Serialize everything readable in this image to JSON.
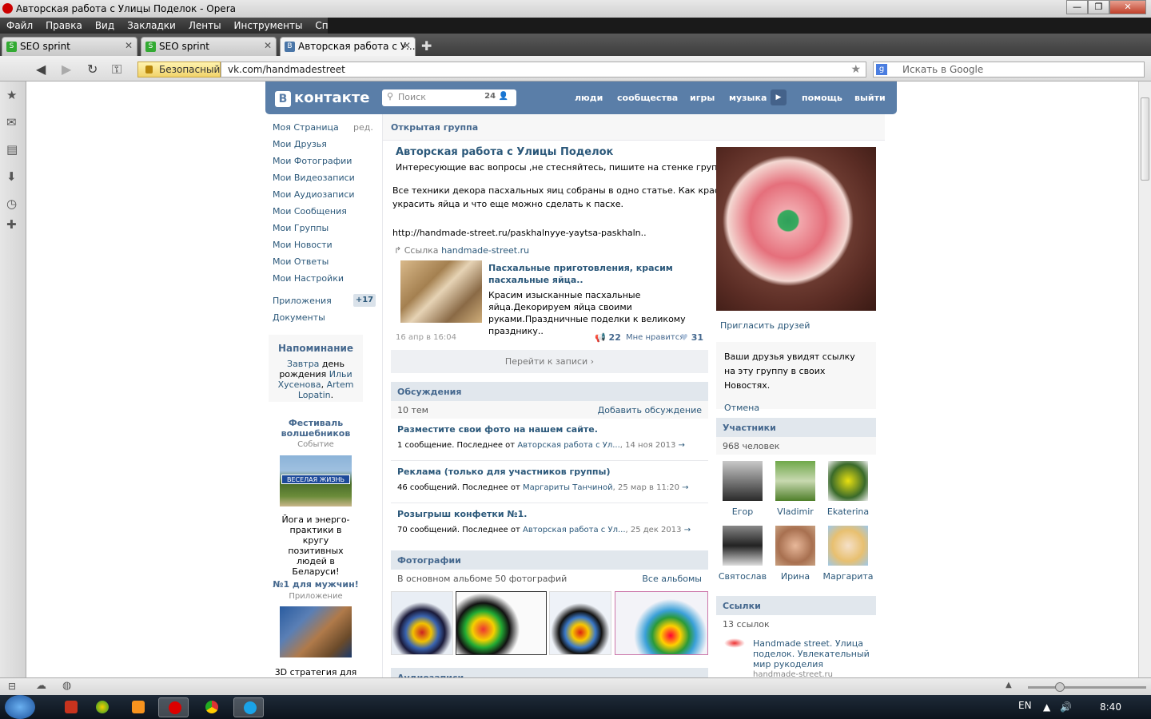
{
  "window": {
    "title": "Авторская работа с Улицы Поделок - Opera",
    "controls": [
      "—",
      "❐",
      "✕"
    ]
  },
  "menu": [
    "Файл",
    "Правка",
    "Вид",
    "Закладки",
    "Ленты",
    "Инструменты",
    "Справка"
  ],
  "tabs": [
    {
      "label": "SEO sprint",
      "icon": "S"
    },
    {
      "label": "SEO sprint",
      "icon": "S"
    },
    {
      "label": "Авторская работа с У...",
      "icon": "B"
    }
  ],
  "address": {
    "security_label": "Безопасный",
    "url": "vk.com/handmadestreet",
    "search_placeholder": "Искать в Google"
  },
  "vk": {
    "logo": "контакте",
    "logo_letter": "B",
    "search_placeholder": "Поиск",
    "search_count": "24",
    "nav": [
      "люди",
      "сообщества",
      "игры",
      "музыка",
      "помощь",
      "выйти"
    ]
  },
  "left_menu": {
    "items": [
      "Моя Страница",
      "Мои Друзья",
      "Мои Фотографии",
      "Мои Видеозаписи",
      "Мои Аудиозаписи",
      "Мои Сообщения",
      "Мои Группы",
      "Мои Новости",
      "Мои Ответы",
      "Мои Настройки"
    ],
    "edit": "ред.",
    "apps": "Приложения",
    "apps_badge": "+17",
    "docs": "Документы",
    "reminder": {
      "title": "Напоминание",
      "w1": "Завтра",
      "t1": " день рождения ",
      "n1": "Ильи Хусенова",
      "t2": ", ",
      "n2": "Artem Lopatin",
      "t3": "."
    },
    "event": {
      "title": "Фестиваль волшебников",
      "type": "Событие",
      "image_text": "ВЕСЕЛАЯ ЖИЗНЬ",
      "desc": "Йога и энерго-практики в кругу позитивных людей в Беларуси!"
    },
    "app": {
      "title": "№1 для мужчин!",
      "type": "Приложение",
      "desc": "3D стратегия для"
    }
  },
  "group": {
    "header": "Открытая группа",
    "title": "Авторская работа с Улицы Поделок",
    "status": "Интересующие вас вопросы ,не стесняйтесь, пишите на стенке группы.",
    "post": {
      "text1": "Все техники декора пасхальных яиц собраны в одно статье. Как красиво",
      "text2": "украсить яйца и что еще можно сделать к пасхе.",
      "link": "http://handmade-street.ru/paskhalnyye-yaytsa-paskhaln..",
      "link_prefix": "Ссылка",
      "link_domain": "handmade-street.ru",
      "card_title": "Пасхальные приготовления, красим пасхальные яйца..",
      "card_desc": "Красим изысканные пасхальные яйца.Декорируем яйца своими руками.Праздничные поделки к великому празднику..",
      "date": "16 апр в 16:04",
      "shares": "22",
      "like_label": "Мне нравится",
      "likes": "31",
      "goto": "Перейти к записи ›"
    },
    "discussions": {
      "title": "Обсуждения",
      "count": "10 тем",
      "add": "Добавить обсуждение",
      "topics": [
        {
          "title": "Разместите свои фото на нашем сайте.",
          "info": "1 сообщение. Последнее от ",
          "author": "Авторская работа с Ул...",
          "date": ", 14 ноя 2013",
          "arrow": "→"
        },
        {
          "title": "Реклама (только для участников группы)",
          "info": "46 сообщений. Последнее от ",
          "author": "Маргариты Танчиной",
          "date": ", 25 мар в 11:20",
          "arrow": "→"
        },
        {
          "title": "Розыгрыш конфетки №1.",
          "info": "70 сообщений. Последнее от ",
          "author": "Авторская работа с Ул...",
          "date": ", 25 дек 2013",
          "arrow": "→"
        }
      ]
    },
    "photos": {
      "title": "Фотографии",
      "info": "В основном альбоме 50 фотографий",
      "all": "Все альбомы"
    },
    "audio_title": "Аудиозаписи"
  },
  "right": {
    "invite": "Пригласить друзей",
    "invite_note": "Ваши друзья увидят ссылку на эту группу в своих Новостях.",
    "cancel": "Отмена",
    "members_title": "Участники",
    "members_count": "968 человек",
    "members": [
      "Егор",
      "Vladimir",
      "Ekaterina",
      "Святослав",
      "Ирина",
      "Маргарита"
    ],
    "links_title": "Ссылки",
    "links_count": "13 ссылок",
    "link_title": "Handmade street. Улица поделок. Увлекательный мир рукоделия",
    "link_domain": "handmade-street.ru"
  },
  "system": {
    "lang": "EN",
    "time": "8:40"
  }
}
